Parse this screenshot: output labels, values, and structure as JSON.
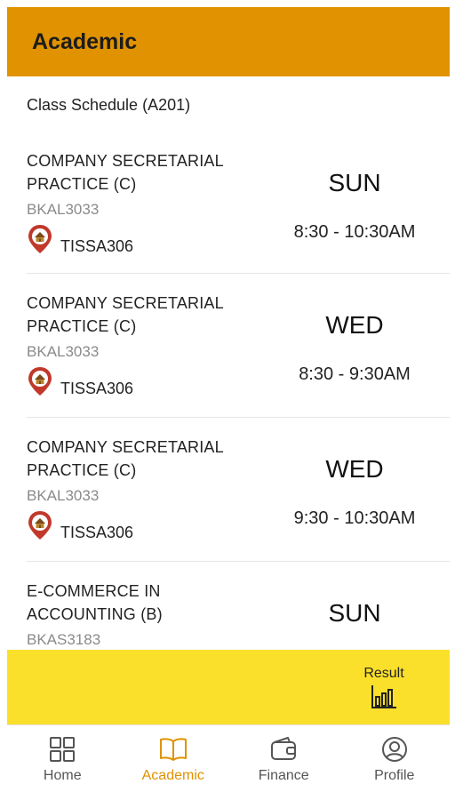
{
  "header": {
    "title": "Academic"
  },
  "schedule": {
    "title": "Class Schedule (A201)",
    "classes": [
      {
        "name": "COMPANY SECRETARIAL PRACTICE (C)",
        "code": "BKAL3033",
        "venue": "TISSA306",
        "day": "SUN",
        "time": "8:30 - 10:30AM"
      },
      {
        "name": "COMPANY SECRETARIAL PRACTICE (C)",
        "code": "BKAL3033",
        "venue": "TISSA306",
        "day": "WED",
        "time": "8:30 - 9:30AM"
      },
      {
        "name": "COMPANY SECRETARIAL PRACTICE (C)",
        "code": "BKAL3033",
        "venue": "TISSA306",
        "day": "WED",
        "time": "9:30 - 10:30AM"
      },
      {
        "name": "E-COMMERCE IN ACCOUNTING (B)",
        "code": "BKAS3183",
        "venue": "",
        "day": "SUN",
        "time": ""
      }
    ]
  },
  "result_button": {
    "label": "Result",
    "icon": "bar-chart-icon"
  },
  "nav": {
    "items": [
      {
        "label": "Home",
        "icon": "grid-icon",
        "active": false
      },
      {
        "label": "Academic",
        "icon": "open-book-icon",
        "active": true
      },
      {
        "label": "Finance",
        "icon": "wallet-icon",
        "active": false
      },
      {
        "label": "Profile",
        "icon": "user-circle-icon",
        "active": false
      }
    ]
  },
  "colors": {
    "appbar": "#E09200",
    "result_bar": "#FAE02A",
    "active_nav": "#E09200",
    "pin": "#C0392B"
  }
}
